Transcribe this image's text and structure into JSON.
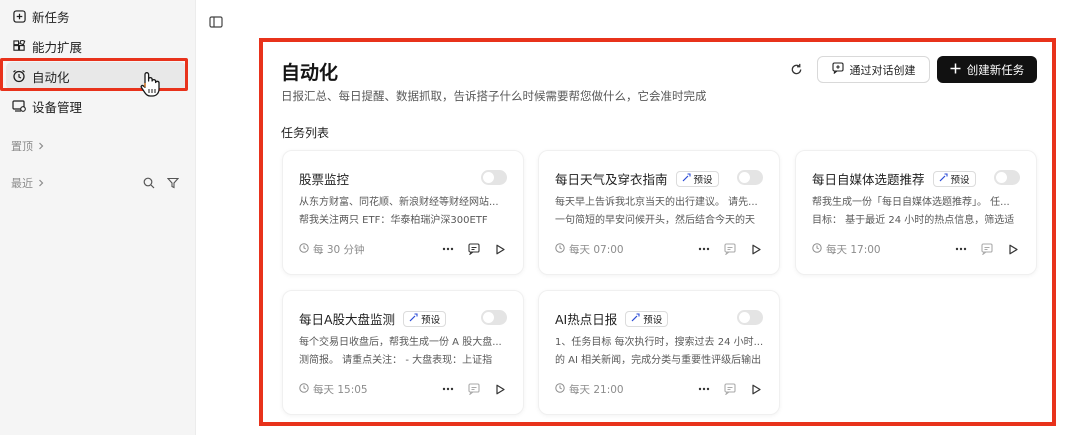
{
  "sidebar": {
    "items": [
      {
        "label": "新任务"
      },
      {
        "label": "能力扩展"
      },
      {
        "label": "自动化"
      },
      {
        "label": "设备管理"
      }
    ],
    "groups": {
      "pinned": "置顶",
      "recent": "最近"
    }
  },
  "header": {
    "title": "自动化",
    "description": "日报汇总、每日提醒、数据抓取，告诉搭子什么时候需要帮您做什么，它会准时完成",
    "section_title": "任务列表",
    "chat_create_label": "通过对话创建",
    "new_task_label": "创建新任务"
  },
  "tasks": [
    {
      "title": "股票监控",
      "badge": "",
      "desc_line1": "从东方财富、同花顺、新浪财经等财经网站...",
      "desc_line2": "帮我关注两只 ETF：华泰柏瑞沪深300ETF",
      "schedule": "每 30 分钟",
      "enabled": false
    },
    {
      "title": "每日天气及穿衣指南",
      "badge": "预设",
      "desc_line1": "每天早上告诉我北京当天的出行建议。 请先...",
      "desc_line2": "一句简短的早安问候开头，然后结合今天的天",
      "schedule": "每天 07:00",
      "enabled": false
    },
    {
      "title": "每日自媒体选题推荐",
      "badge": "预设",
      "desc_line1": "帮我生成一份「每日自媒体选题推荐」。 任...",
      "desc_line2": "目标： 基于最近 24 小时的热点信息，筛选适",
      "schedule": "每天 17:00",
      "enabled": false
    },
    {
      "title": "每日A股大盘监测",
      "badge": "预设",
      "desc_line1": "每个交易日收盘后，帮我生成一份 A 股大盘...",
      "desc_line2": "测简报。 请重点关注： - 大盘表现：上证指",
      "schedule": "每天 15:05",
      "enabled": false
    },
    {
      "title": "AI热点日报",
      "badge": "预设",
      "desc_line1": "1、任务目标 每次执行时，搜索过去 24 小时...",
      "desc_line2": "的 AI 相关新闻，完成分类与重要性评级后输出",
      "schedule": "每天 21:00",
      "enabled": false
    }
  ],
  "colors": {
    "highlight": "#e8321b",
    "primary_button": "#111111",
    "sidebar_bg": "#f5f5f5"
  }
}
